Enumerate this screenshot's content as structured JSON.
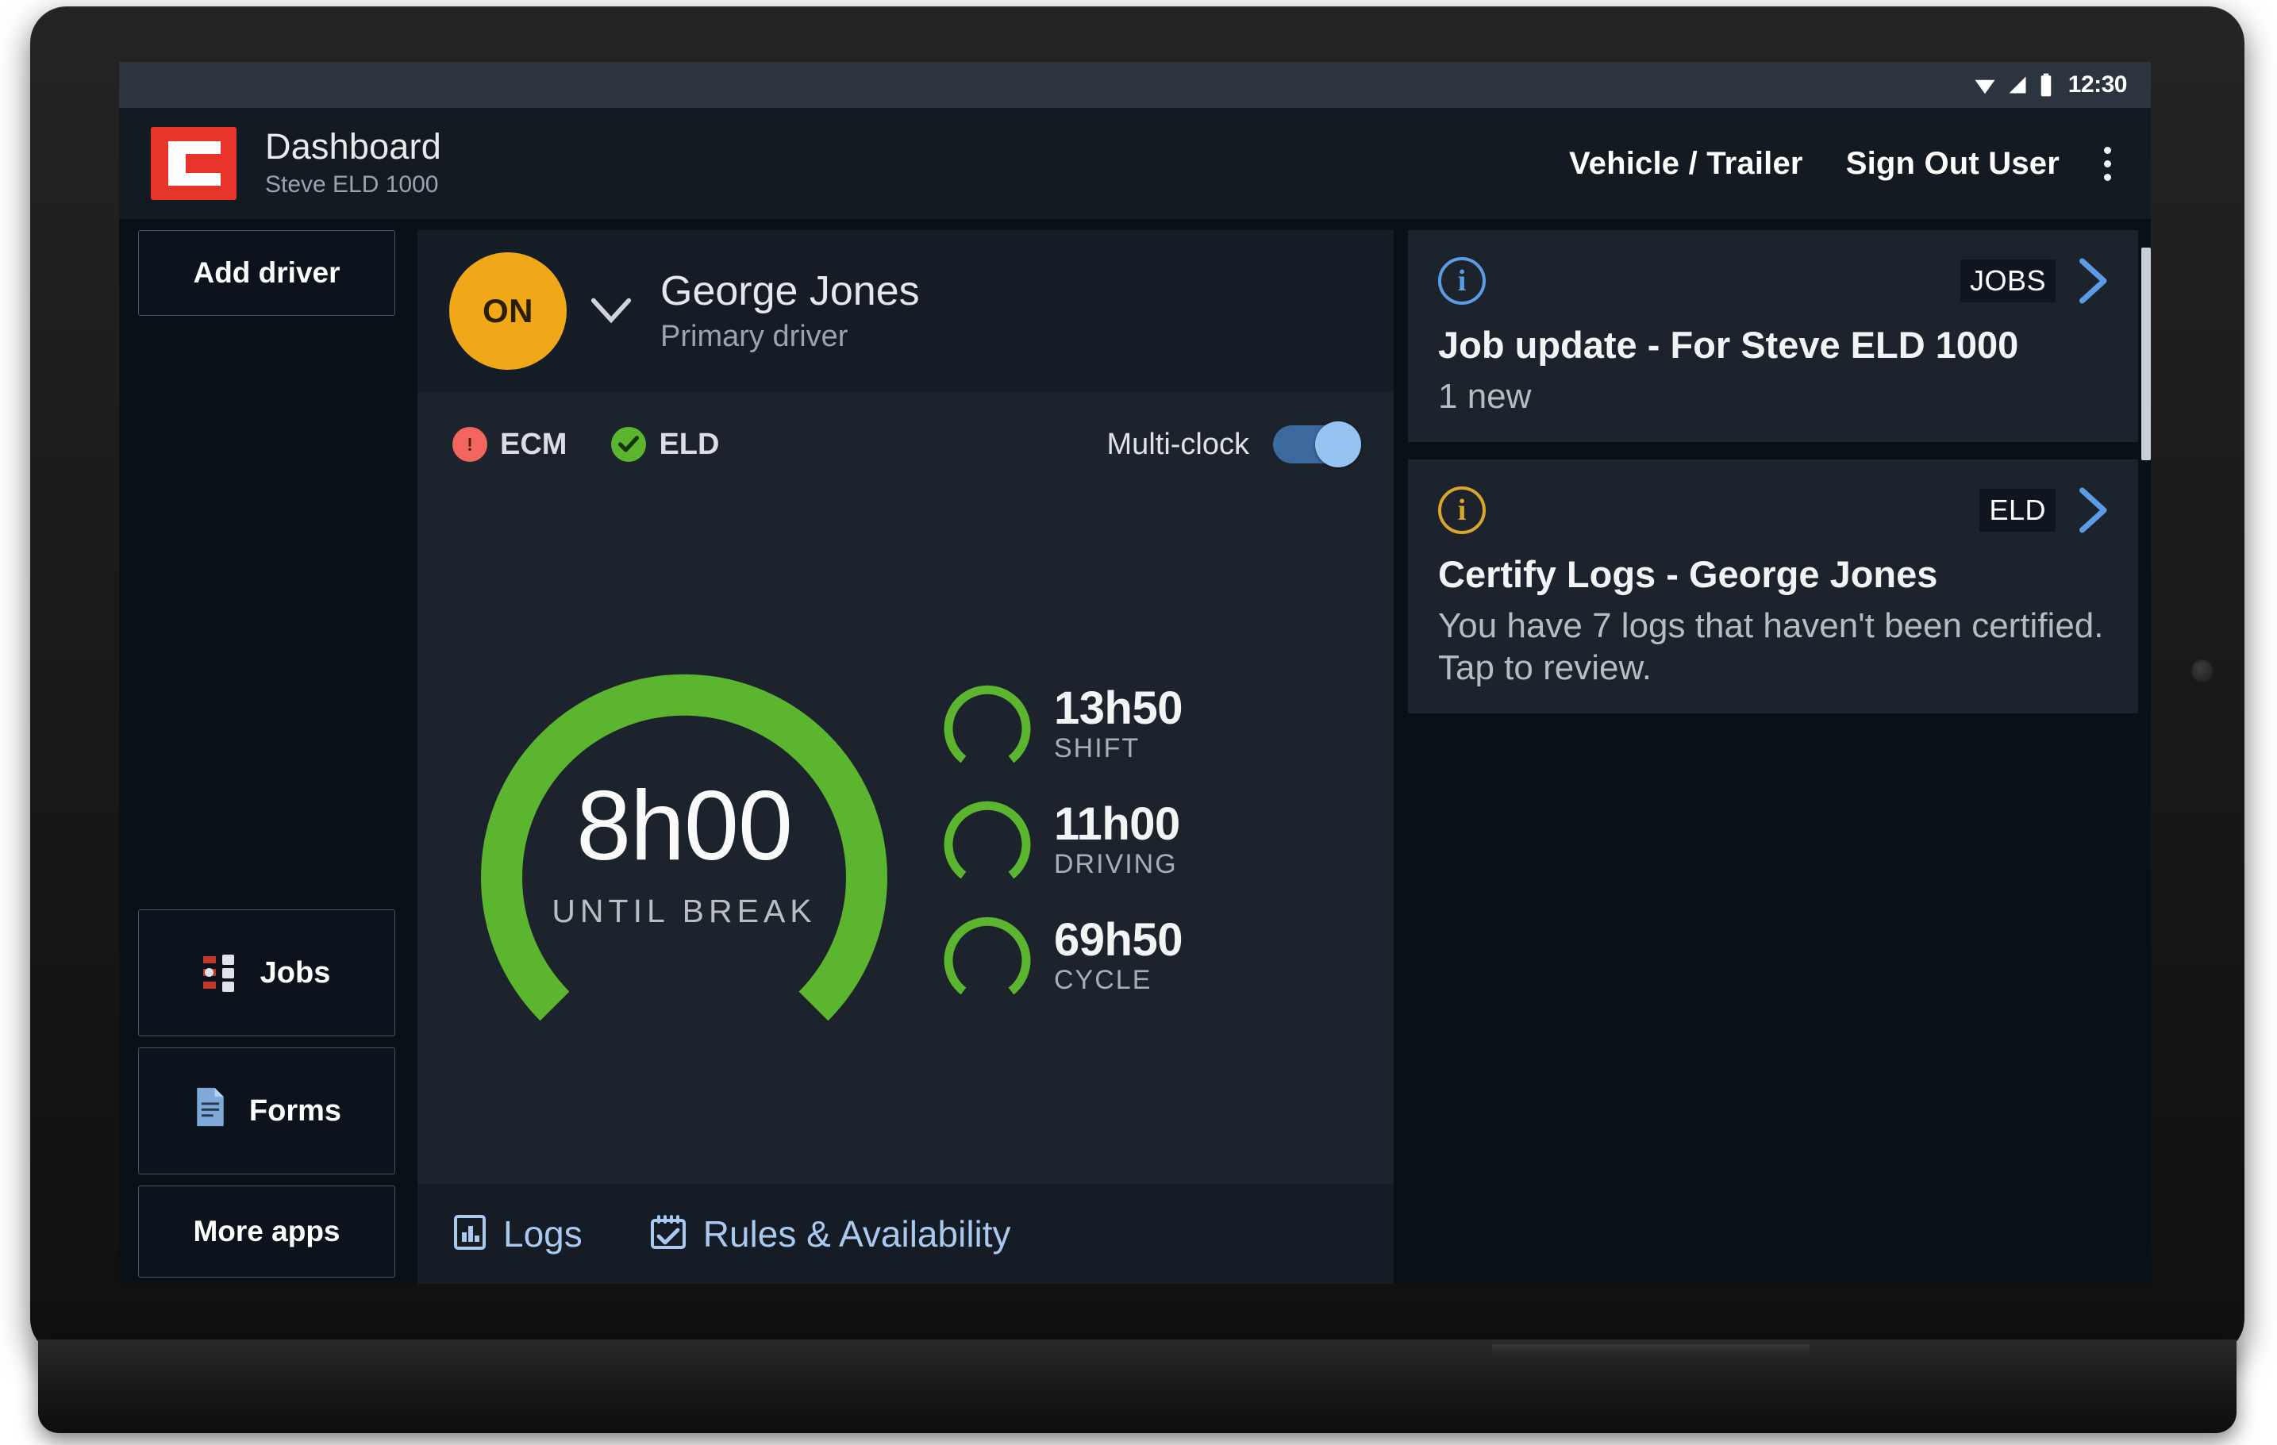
{
  "status_bar": {
    "time": "12:30",
    "icons": [
      "wifi-icon",
      "cellular-signal-icon",
      "battery-icon"
    ]
  },
  "app_bar": {
    "logo_icon": "eld-logo-icon",
    "title": "Dashboard",
    "subtitle": "Steve ELD 1000",
    "actions": [
      {
        "label": "Vehicle / Trailer"
      },
      {
        "label": "Sign Out User"
      }
    ],
    "overflow_icon": "overflow-menu-icon"
  },
  "sidebar": {
    "add_driver_label": "Add driver",
    "items": [
      {
        "label": "Jobs",
        "icon": "jobs-list-icon"
      },
      {
        "label": "Forms",
        "icon": "document-icon"
      }
    ],
    "more_apps_label": "More apps"
  },
  "driver_card": {
    "status_badge": "ON",
    "status_chevron_icon": "chevron-down-icon",
    "name": "George Jones",
    "role": "Primary driver",
    "indicators": [
      {
        "label": "ECM",
        "icon": "alert-circle-icon",
        "color": "#f1665f",
        "state": "alert"
      },
      {
        "label": "ELD",
        "icon": "check-circle-icon",
        "color": "#5bb52e",
        "state": "ok"
      }
    ],
    "multiclock_label": "Multi-clock",
    "multiclock_on": true,
    "footer": [
      {
        "label": "Logs",
        "icon": "logs-icon"
      },
      {
        "label": "Rules & Availability",
        "icon": "calendar-check-icon"
      }
    ]
  },
  "chart_data": {
    "type": "gauge",
    "title": "Hours of Service clocks",
    "accent_color": "#5cb52e",
    "main": {
      "value_text": "8h00",
      "label": "UNTIL BREAK",
      "value_hours": 8.0,
      "max_hours": 8.0,
      "percent": 100
    },
    "mini": [
      {
        "value_text": "13h50",
        "label": "SHIFT",
        "value_hours": 13.833,
        "max_hours": 14,
        "percent": 99
      },
      {
        "value_text": "11h00",
        "label": "DRIVING",
        "value_hours": 11.0,
        "max_hours": 11,
        "percent": 100
      },
      {
        "value_text": "69h50",
        "label": "CYCLE",
        "value_hours": 69.833,
        "max_hours": 70,
        "percent": 99
      }
    ]
  },
  "notifications": [
    {
      "icon": "info-circle-icon",
      "icon_color": "#5c9ce6",
      "tag": "JOBS",
      "chevron_icon": "chevron-right-icon",
      "title": "Job update - For Steve ELD 1000",
      "body": "1 new"
    },
    {
      "icon": "info-circle-icon",
      "icon_color": "#d8a62a",
      "tag": "ELD",
      "chevron_icon": "chevron-right-icon",
      "title": "Certify Logs - George Jones",
      "body": "You have 7 logs that haven't been certified. Tap to review."
    }
  ]
}
